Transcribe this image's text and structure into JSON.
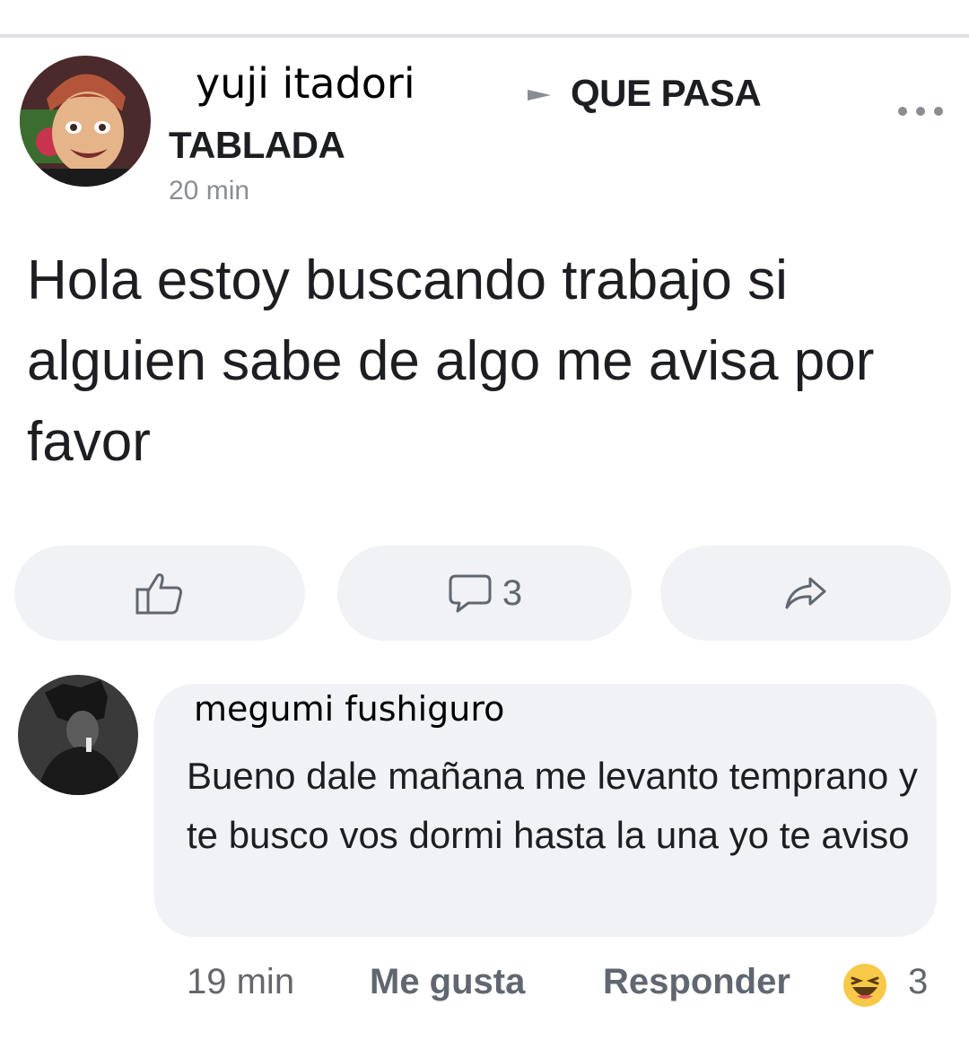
{
  "post": {
    "author": "yuji itadori",
    "group_line1": "QUE PASA",
    "group_line2": "TABLADA",
    "time": "20 min",
    "text": "Hola estoy buscando trabajo si alguien sabe de algo me avisa por favor",
    "comment_count": "3"
  },
  "comment": {
    "author": "megumi fushiguro",
    "text": "Bueno dale mañana me levanto temprano y te busco vos dormi hasta la una yo te aviso",
    "time": "19 min",
    "like_label": "Me gusta",
    "reply_label": "Responder",
    "reaction_count": "3"
  },
  "icons": {
    "more": "more-options-icon",
    "like": "thumbs-up-icon",
    "comment": "comment-bubble-icon",
    "share": "share-arrow-icon",
    "arrow": "right-triangle-icon",
    "haha": "haha-reaction-icon"
  },
  "colors": {
    "background": "#ffffff",
    "button_bg": "#f0f2f5",
    "muted_text": "#606770",
    "divider": "#dddfe2"
  }
}
